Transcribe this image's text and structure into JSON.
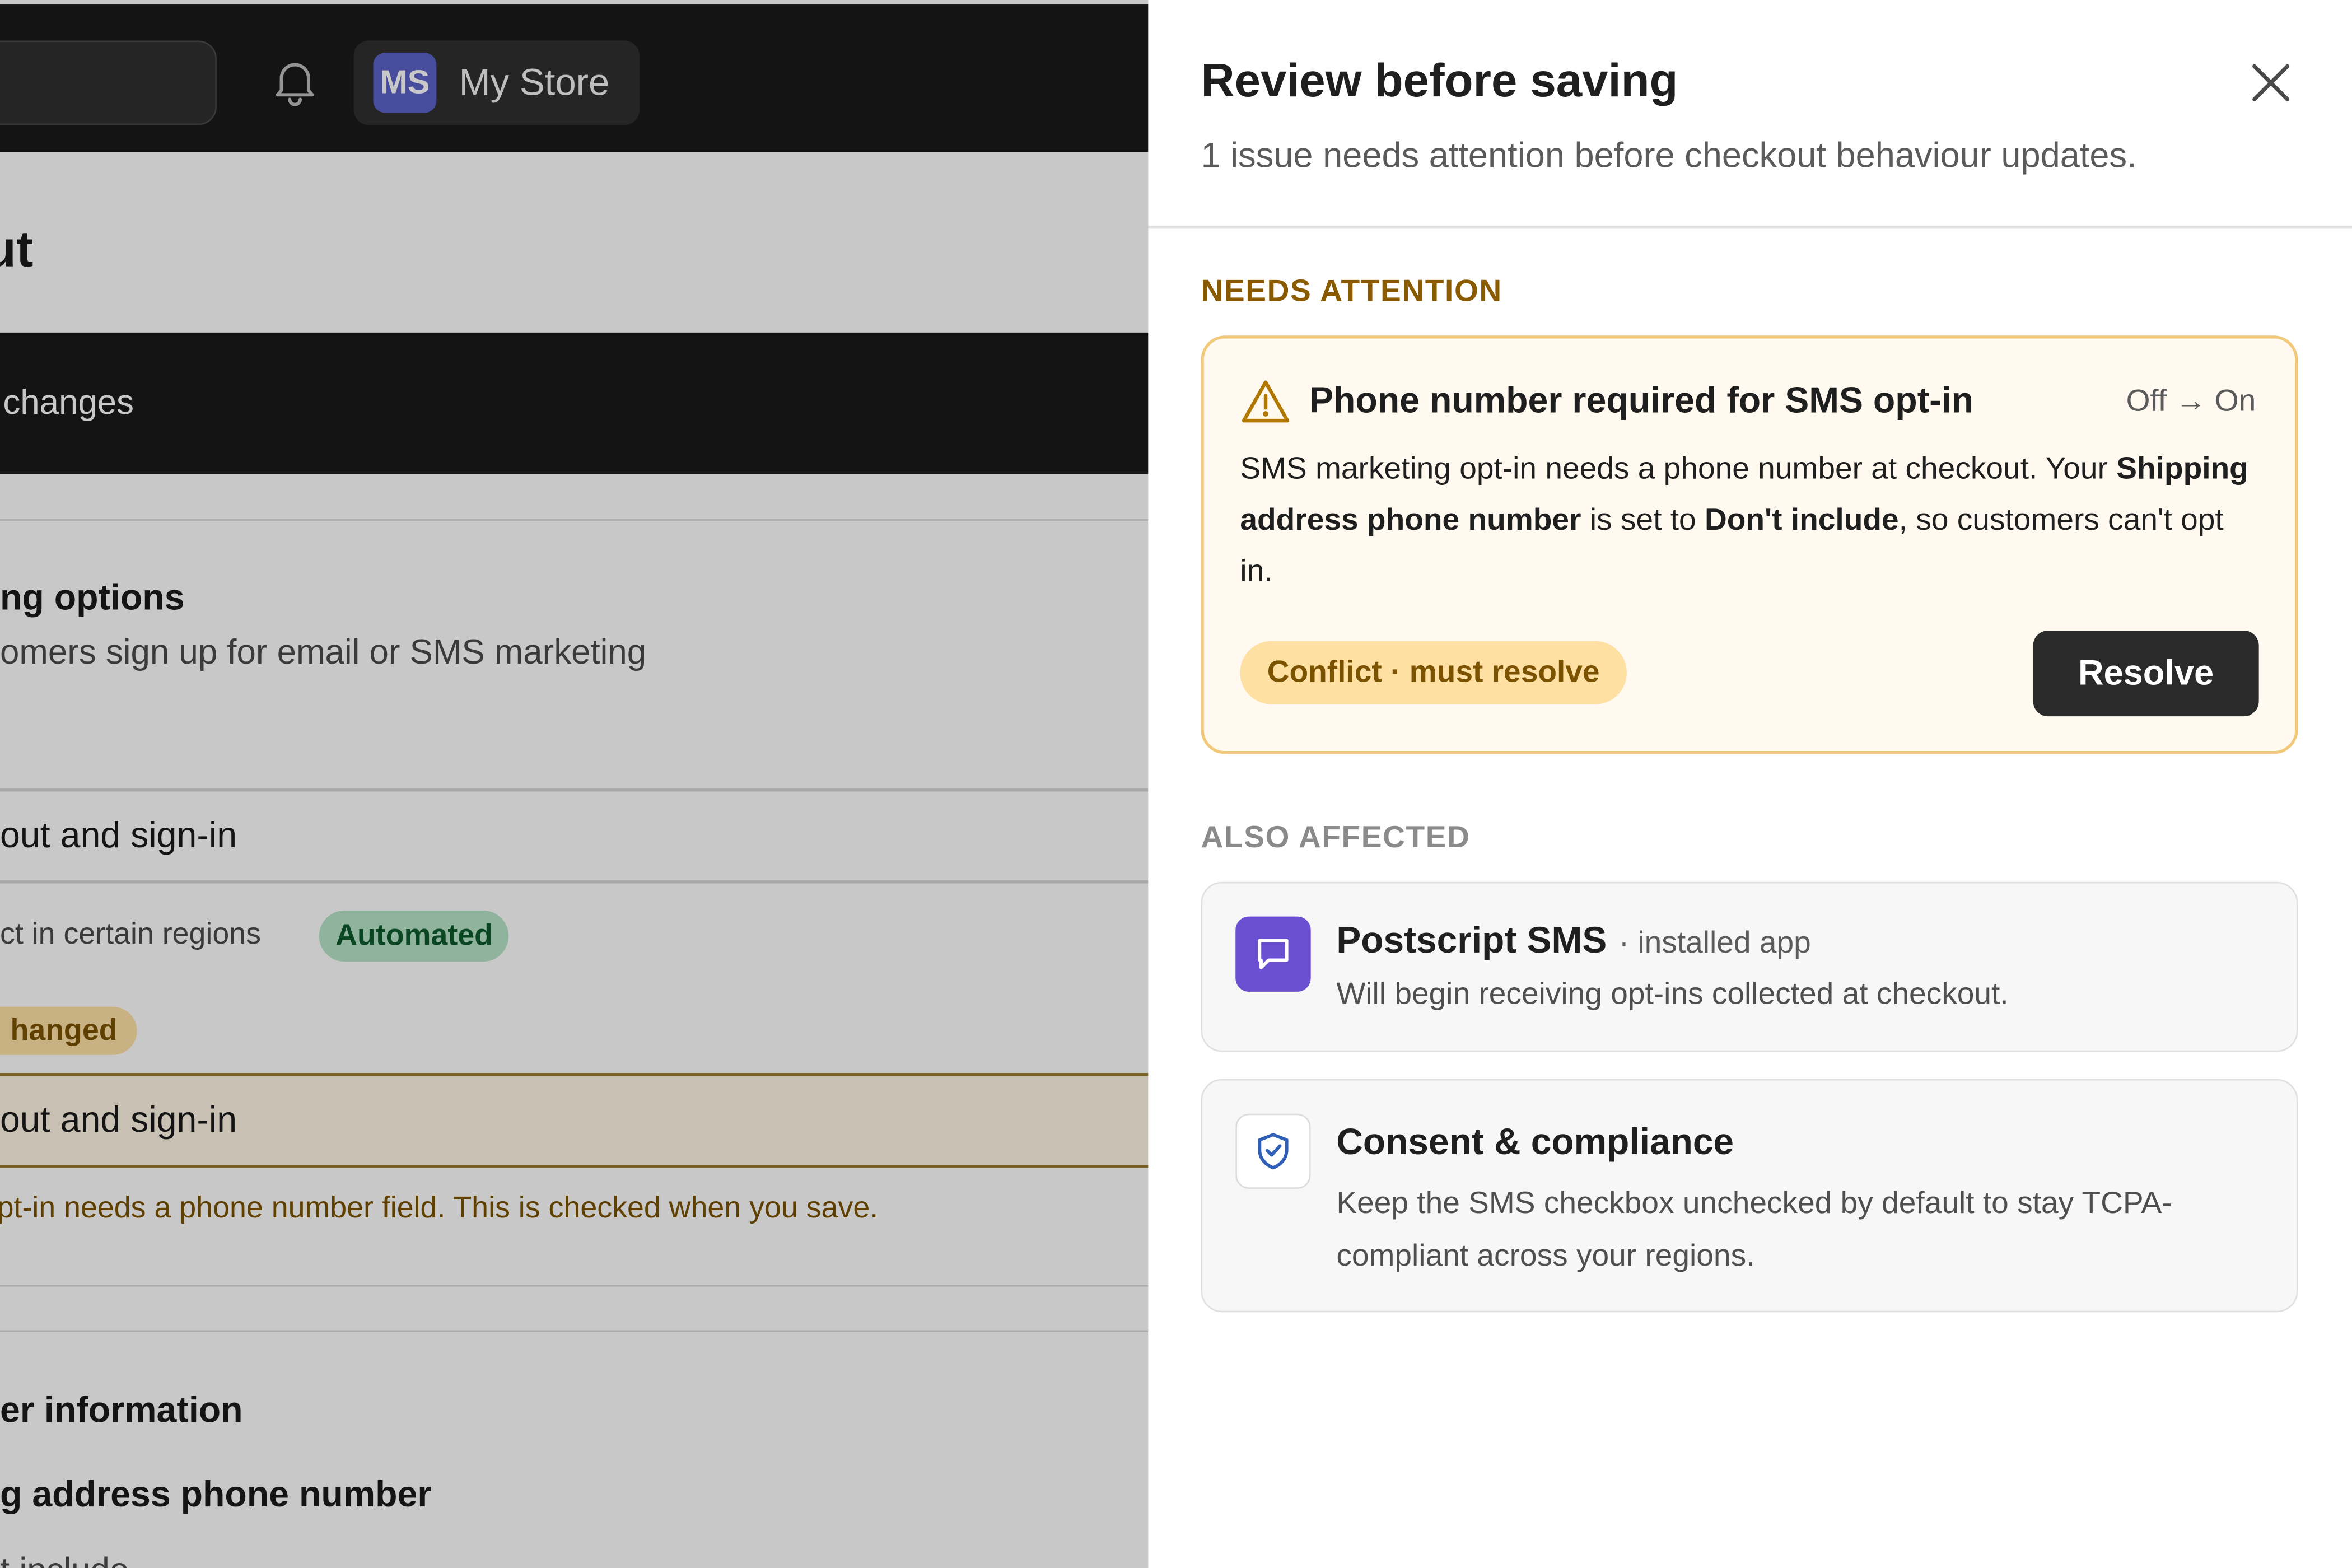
{
  "colors": {
    "accent_warning": "#f2c97a",
    "warning_text": "#7a5200",
    "primary_button": "#2a2a2a",
    "app_purple": "#6a4fd0",
    "shield_blue": "#2f5fb7",
    "automated_badge": "#b7e4c9"
  },
  "background": {
    "topbar": {
      "bell_icon": "bell-icon",
      "avatar_initials": "MS",
      "store_name": "My Store"
    },
    "page_title": "ut",
    "unsaved_bar": "changes",
    "marketing": {
      "heading": "ng options",
      "description": "omers sign up for email or SMS marketing"
    },
    "rows": {
      "row1": "out and sign-in",
      "row2": "ct in certain regions",
      "automated_badge": "Automated",
      "changed_badge": "hanged",
      "row3": "out and sign-in",
      "warning": "pt-in needs a phone number field. This is checked when you save."
    },
    "customer_info": {
      "heading": "er information",
      "field_label": "g address phone number",
      "field_value": "t include"
    }
  },
  "drawer": {
    "title": "Review before saving",
    "subtitle": "1 issue needs attention before checkout behaviour updates.",
    "close_icon": "close-icon",
    "needs_attention": {
      "label": "NEEDS ATTENTION",
      "issue": {
        "icon": "warning-triangle-icon",
        "title": "Phone number required for SMS opt-in",
        "change": "Off → On",
        "desc_part1": "SMS marketing opt-in needs a phone number at checkout. Your ",
        "desc_bold1": "Shipping address phone number",
        "desc_part2": " is set to ",
        "desc_bold2": "Don't include",
        "desc_part3": ", so customers can't opt in.",
        "status_pill": "Conflict · must resolve",
        "resolve_label": "Resolve"
      }
    },
    "also_affected": {
      "label": "ALSO AFFECTED",
      "items": [
        {
          "icon": "chat-bubble-icon",
          "name": "Postscript SMS",
          "meta": "· installed app",
          "description": "Will begin receiving opt-ins collected at checkout."
        },
        {
          "icon": "shield-check-icon",
          "name": "Consent & compliance",
          "description": "Keep the SMS checkbox unchecked by default to stay TCPA-compliant across your regions."
        }
      ]
    }
  }
}
